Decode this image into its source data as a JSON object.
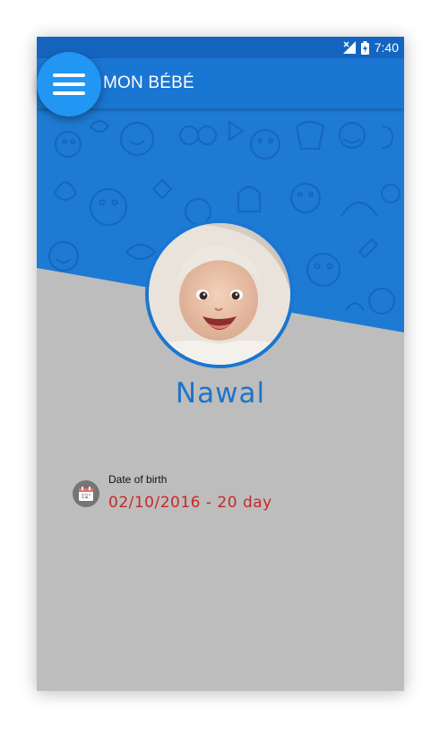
{
  "statusbar": {
    "time": "7:40",
    "icons": [
      "signal-icon",
      "battery-icon"
    ]
  },
  "toolbar": {
    "title": "MON BÉBÉ",
    "menu_icon": "hamburger-menu-icon"
  },
  "profile": {
    "name": "Nawal",
    "dob_label": "Date of birth",
    "dob_value": "02/10/2016 - 20 day",
    "dob_icon": "calendar-icon"
  },
  "colors": {
    "primary": "#1976d2",
    "primary_dark": "#1565c0",
    "fab": "#2196f3",
    "name_color": "#1e74c8",
    "dob_value_color": "#c62828",
    "background": "#bdbdbd"
  }
}
